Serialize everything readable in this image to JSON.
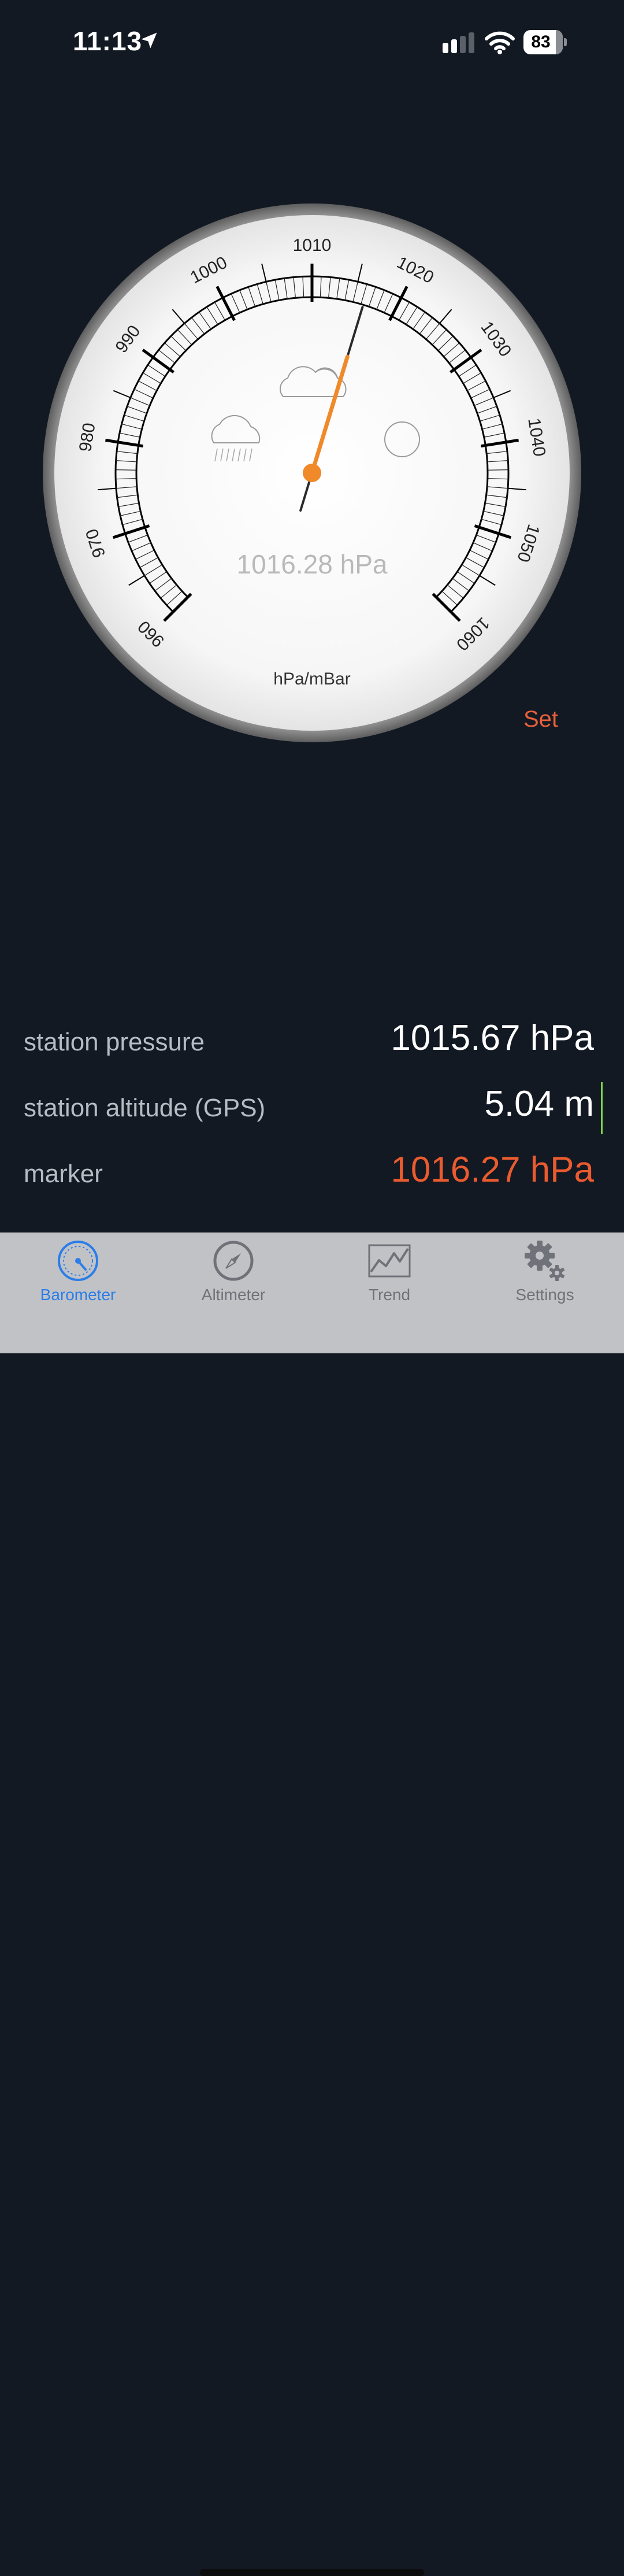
{
  "status_bar": {
    "time": "11:13",
    "battery": "83",
    "battery_level": 0.83
  },
  "gauge": {
    "scale_labels": [
      "960",
      "970",
      "980",
      "990",
      "1000",
      "1010",
      "1020",
      "1030",
      "1040",
      "1050",
      "1060"
    ],
    "scale_min": 960,
    "scale_max": 1060,
    "needle_value": 1016.28,
    "reading": "1016.28 hPa",
    "unit": "hPa/mBar",
    "colors": {
      "needle": "#f0892a",
      "dial": "#f5f5f5"
    },
    "icons": [
      "rain-cloud-icon",
      "cloud-icon",
      "sun-icon"
    ]
  },
  "set_label": "Set",
  "readings": [
    {
      "label": "station pressure",
      "value": "1015.67 hPa"
    },
    {
      "label": "station altitude (GPS)",
      "value": "5.04 m"
    },
    {
      "label": "marker",
      "value": "1016.27 hPa"
    }
  ],
  "tabs": [
    {
      "label": "Barometer",
      "icon": "barometer-icon",
      "active": true
    },
    {
      "label": "Altimeter",
      "icon": "compass-icon",
      "active": false
    },
    {
      "label": "Trend",
      "icon": "trend-chart-icon",
      "active": false
    },
    {
      "label": "Settings",
      "icon": "gear-icon",
      "active": false
    }
  ],
  "colors": {
    "background": "#121923",
    "accent": "#ea5b2f",
    "active_tab": "#2b7de9"
  }
}
